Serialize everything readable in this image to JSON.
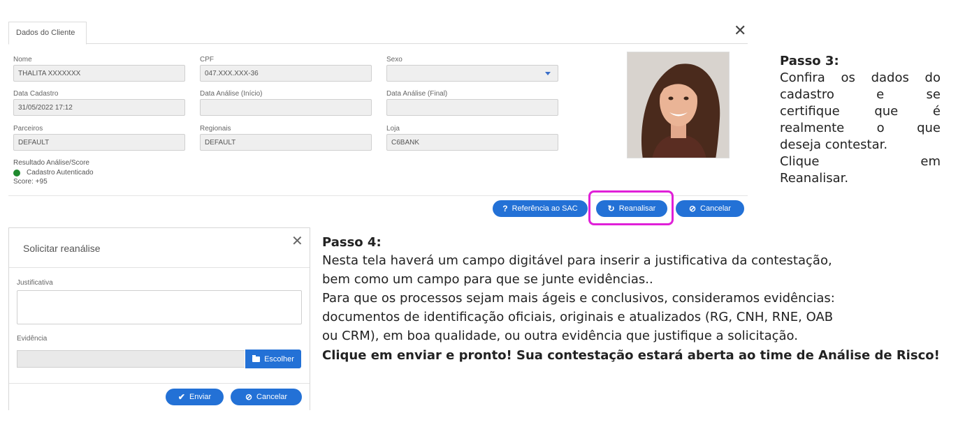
{
  "client_panel": {
    "tab_label": "Dados do Cliente",
    "close_glyph": "✕",
    "fields": {
      "nome": {
        "label": "Nome",
        "value": "THALITA XXXXXXX"
      },
      "cpf": {
        "label": "CPF",
        "value": "047.XXX.XXX-36"
      },
      "sexo": {
        "label": "Sexo",
        "value": ""
      },
      "data_cadastro": {
        "label": "Data Cadastro",
        "value": "31/05/2022 17:12"
      },
      "data_analise_inicio": {
        "label": "Data Análise (Início)",
        "value": ""
      },
      "data_analise_final": {
        "label": "Data Análise (Final)",
        "value": ""
      },
      "parceiros": {
        "label": "Parceiros",
        "value": "DEFAULT"
      },
      "regionais": {
        "label": "Regionais",
        "value": "DEFAULT"
      },
      "loja": {
        "label": "Loja",
        "value": "C6BANK"
      }
    },
    "result": {
      "label": "Resultado Análise/Score",
      "status": "Cadastro Autenticado",
      "status_color": "#1f8a2e",
      "score": "Score: +95"
    },
    "photo_icon": "portrait-photo",
    "buttons": {
      "sac": {
        "icon": "?",
        "label": "Referência ao SAC"
      },
      "reanalisar": {
        "icon": "↻",
        "label": "Reanalisar"
      },
      "cancelar": {
        "icon": "⊘",
        "label": "Cancelar"
      }
    },
    "accent_color": "#2371d6",
    "highlight_color": "#e020d8"
  },
  "step3": {
    "heading": "Passo 3:",
    "lines": [
      [
        "Confira",
        "os",
        "dados",
        "do"
      ],
      [
        "cadastro",
        "e",
        "se"
      ],
      [
        "certifique",
        "que",
        "é"
      ],
      [
        "realmente",
        "o",
        "que"
      ],
      [
        "deseja contestar."
      ],
      [
        "Clique",
        "em"
      ],
      [
        "Reanalisar."
      ]
    ]
  },
  "modal": {
    "title": "Solicitar reanálise",
    "close_glyph": "✕",
    "justificativa_label": "Justificativa",
    "justificativa_value": "",
    "evidencia_label": "Evidência",
    "evidencia_value": "",
    "choose_label": "Escolher",
    "enviar": {
      "icon": "✔",
      "label": "Enviar"
    },
    "cancelar": {
      "icon": "⊘",
      "label": "Cancelar"
    }
  },
  "step4": {
    "heading": "Passo 4:",
    "lines": [
      "Nesta tela haverá um campo digitável para inserir a justificativa da contestação,",
      "bem como um campo para que se junte evidências..",
      "Para que os processos sejam mais ágeis e conclusivos, consideramos evidências:",
      "documentos de identificação oficiais, originais e atualizados (RG, CNH, RNE, OAB",
      "ou CRM), em boa qualidade, ou outra evidência que justifique a solicitação."
    ],
    "bold_text": "Clique em enviar e pronto! Sua contestação estará aberta ao time de Análise de Risco!"
  }
}
